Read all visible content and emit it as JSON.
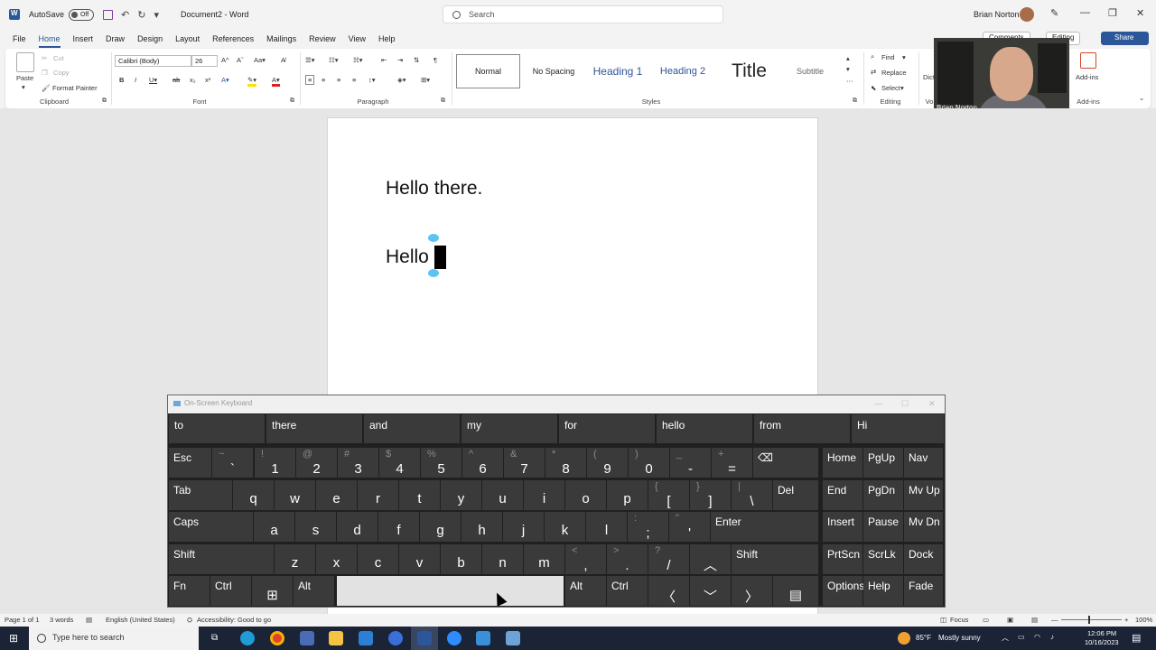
{
  "titlebar": {
    "autosave_label": "AutoSave",
    "autosave_state": "Off",
    "doc_title": "Document2 - Word",
    "search_placeholder": "Search",
    "user": "Brian Norton"
  },
  "menu": [
    "File",
    "Home",
    "Insert",
    "Draw",
    "Design",
    "Layout",
    "References",
    "Mailings",
    "Review",
    "View",
    "Help"
  ],
  "menu_active": "Home",
  "ribbon_right": {
    "comments": "Comments",
    "editing": "Editing",
    "share": "Share"
  },
  "clipboard": {
    "paste": "Paste",
    "cut": "Cut",
    "copy": "Copy",
    "format_painter": "Format Painter",
    "label": "Clipboard"
  },
  "font": {
    "name": "Calibri (Body)",
    "size": "26",
    "label": "Font"
  },
  "paragraph": {
    "label": "Paragraph"
  },
  "styles": {
    "items": [
      "Normal",
      "No Spacing",
      "Heading 1",
      "Heading 2",
      "Title",
      "Subtitle"
    ],
    "selected": "Normal",
    "label": "Styles"
  },
  "editing": {
    "find": "Find",
    "replace": "Replace",
    "select": "Select",
    "label": "Editing"
  },
  "dictate": {
    "label": "Dict",
    "group": "Vo"
  },
  "addins": {
    "label": "Add-ins",
    "group": "Add-ins"
  },
  "webcam": {
    "name": "Brian Norton"
  },
  "document": {
    "line1": "Hello there.",
    "line2": "Hello"
  },
  "osk": {
    "title": "On-Screen Keyboard",
    "predictions": [
      "to",
      "there",
      "and",
      "my",
      "for",
      "hello",
      "from",
      "Hi"
    ],
    "row1": [
      {
        "p": "Esc"
      },
      {
        "s": "~",
        "b": "`"
      },
      {
        "s": "!",
        "b": "1"
      },
      {
        "s": "@",
        "b": "2"
      },
      {
        "s": "#",
        "b": "3"
      },
      {
        "s": "$",
        "b": "4"
      },
      {
        "s": "%",
        "b": "5"
      },
      {
        "s": "^",
        "b": "6"
      },
      {
        "s": "&",
        "b": "7"
      },
      {
        "s": "*",
        "b": "8"
      },
      {
        "s": "(",
        "b": "9"
      },
      {
        "s": ")",
        "b": "0"
      },
      {
        "s": "_",
        "b": "-"
      },
      {
        "s": "+",
        "b": "="
      },
      {
        "p": "⌫"
      },
      {
        "p": "Home"
      },
      {
        "p": "PgUp"
      },
      {
        "p": "Nav"
      }
    ],
    "row2": [
      {
        "p": "Tab"
      },
      {
        "m": "q"
      },
      {
        "m": "w"
      },
      {
        "m": "e"
      },
      {
        "m": "r"
      },
      {
        "m": "t"
      },
      {
        "m": "y"
      },
      {
        "m": "u"
      },
      {
        "m": "i"
      },
      {
        "m": "o"
      },
      {
        "m": "p"
      },
      {
        "s": "{",
        "b": "["
      },
      {
        "s": "}",
        "b": "]"
      },
      {
        "s": "|",
        "b": "\\"
      },
      {
        "p": "Del"
      },
      {
        "p": "End"
      },
      {
        "p": "PgDn"
      },
      {
        "p": "Mv Up"
      }
    ],
    "row3": [
      {
        "p": "Caps"
      },
      {
        "m": "a"
      },
      {
        "m": "s"
      },
      {
        "m": "d"
      },
      {
        "m": "f"
      },
      {
        "m": "g"
      },
      {
        "m": "h"
      },
      {
        "m": "j"
      },
      {
        "m": "k"
      },
      {
        "m": "l"
      },
      {
        "s": ":",
        "b": ";"
      },
      {
        "s": "\"",
        "b": "'"
      },
      {
        "p": "Enter"
      },
      {
        "p": "Insert"
      },
      {
        "p": "Pause"
      },
      {
        "p": "Mv Dn"
      }
    ],
    "row4": [
      {
        "p": "Shift"
      },
      {
        "m": "z"
      },
      {
        "m": "x"
      },
      {
        "m": "c"
      },
      {
        "m": "v"
      },
      {
        "m": "b"
      },
      {
        "m": "n"
      },
      {
        "m": "m"
      },
      {
        "s": "<",
        "b": ","
      },
      {
        "s": ">",
        "b": "."
      },
      {
        "s": "?",
        "b": "/"
      },
      {
        "m": "︿"
      },
      {
        "p": "Shift"
      },
      {
        "p": "PrtScn"
      },
      {
        "p": "ScrLk"
      },
      {
        "p": "Dock"
      }
    ],
    "row5": [
      {
        "p": "Fn"
      },
      {
        "p": "Ctrl"
      },
      {
        "m": "⊞"
      },
      {
        "p": "Alt"
      },
      {
        "p": ""
      },
      {
        "p": "Alt"
      },
      {
        "p": "Ctrl"
      },
      {
        "m": "〈"
      },
      {
        "m": "﹀"
      },
      {
        "m": "〉"
      },
      {
        "m": "▤"
      },
      {
        "p": "Options"
      },
      {
        "p": "Help"
      },
      {
        "p": "Fade"
      }
    ]
  },
  "statusbar": {
    "page": "Page 1 of 1",
    "words": "3 words",
    "language": "English (United States)",
    "accessibility": "Accessibility: Good to go",
    "focus": "Focus",
    "zoom": "100%"
  },
  "taskbar": {
    "search": "Type here to search",
    "weather_temp": "85°F",
    "weather_desc": "Mostly sunny",
    "time": "12:06 PM",
    "date": "10/16/2023"
  }
}
